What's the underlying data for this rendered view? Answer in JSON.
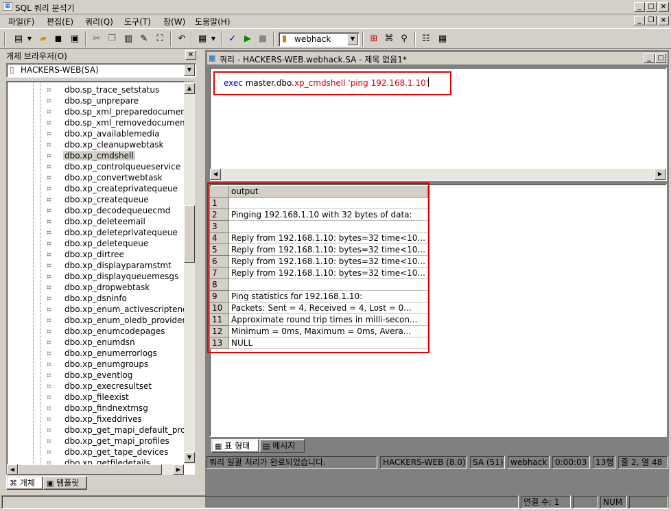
{
  "window": {
    "title": "SQL 쿼리 분석기"
  },
  "menu": [
    "파일(F)",
    "편집(E)",
    "쿼리(Q)",
    "도구(T)",
    "창(W)",
    "도움말(H)"
  ],
  "toolbar": {
    "database": "webhack"
  },
  "object_browser": {
    "title": "개체 브라우저(O)",
    "server": "HACKERS-WEB(SA)",
    "items": [
      "dbo.sp_trace_setstatus",
      "dbo.sp_unprepare",
      "dbo.sp_xml_preparedocument",
      "dbo.sp_xml_removedocument",
      "dbo.xp_availablemedia",
      "dbo.xp_cleanupwebtask",
      "dbo.xp_cmdshell",
      "dbo.xp_controlqueueservice",
      "dbo.xp_convertwebtask",
      "dbo.xp_createprivatequeue",
      "dbo.xp_createqueue",
      "dbo.xp_decodequeuecmd",
      "dbo.xp_deleteemail",
      "dbo.xp_deleteprivatequeue",
      "dbo.xp_deletequeue",
      "dbo.xp_dirtree",
      "dbo.xp_displayparamstmt",
      "dbo.xp_displayqueuemesgs",
      "dbo.xp_dropwebtask",
      "dbo.xp_dsninfo",
      "dbo.xp_enum_activescriptengin",
      "dbo.xp_enum_oledb_providers",
      "dbo.xp_enumcodepages",
      "dbo.xp_enumdsn",
      "dbo.xp_enumerrorlogs",
      "dbo.xp_enumgroups",
      "dbo.xp_eventlog",
      "dbo.xp_execresultset",
      "dbo.xp_fileexist",
      "dbo.xp_findnextmsg",
      "dbo.xp_fixeddrives",
      "dbo.xp_get_mapi_default_profile",
      "dbo.xp_get_mapi_profiles",
      "dbo.xp_get_tape_devices",
      "dbo.xp_getfiledetails"
    ],
    "selected_index": 6,
    "tabs": [
      "개체",
      "템플릿"
    ]
  },
  "query_window": {
    "title": "쿼리 - HACKERS-WEB.webhack.SA - 제목 없음1*",
    "sql": {
      "kw": "exec",
      "db": "master.dbo.",
      "proc": "xp_cmdshell",
      "arg": "'ping 192.168.1.10'"
    }
  },
  "results": {
    "column": "output",
    "rows": [
      "",
      "Pinging 192.168.1.10 with 32 bytes of data:",
      "",
      "Reply from 192.168.1.10: bytes=32 time<10...",
      "Reply from 192.168.1.10: bytes=32 time<10...",
      "Reply from 192.168.1.10: bytes=32 time<10...",
      "Reply from 192.168.1.10: bytes=32 time<10...",
      "",
      "Ping statistics for 192.168.1.10:",
      "    Packets: Sent = 4, Received = 4, Lost = 0...",
      "Approximate round trip times in milli-secon...",
      "    Minimum = 0ms, Maximum =  0ms, Avera...",
      "NULL"
    ],
    "row_numbers": [
      "1",
      "2",
      "3",
      "4",
      "5",
      "6",
      "7",
      "8",
      "9",
      "10",
      "11",
      "12",
      "13"
    ],
    "tabs": [
      "표 형태",
      "메시지"
    ]
  },
  "status": {
    "message": "쿼리 일괄 처리가 완료되었습니다.",
    "server": "HACKERS-WEB (8.0)",
    "user": "SA (51)",
    "db": "webhack",
    "time": "0:00:03",
    "rows": "13행",
    "position": "줄 2, 열 48"
  },
  "footer": {
    "connections": "연결 수: 1",
    "num": "NUM"
  }
}
